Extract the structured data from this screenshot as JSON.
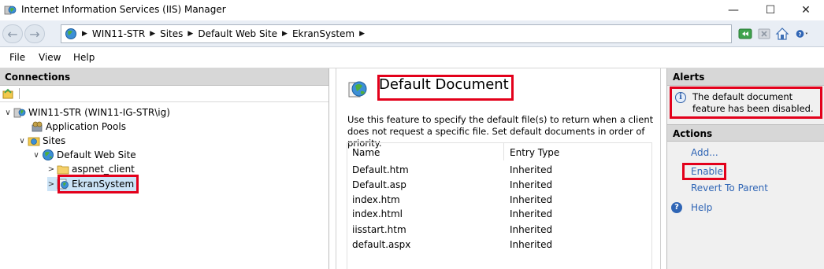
{
  "window": {
    "title": "Internet Information Services (IIS) Manager",
    "minimize_glyph": "—",
    "maximize_glyph": "☐",
    "close_glyph": "✕"
  },
  "address": {
    "back_glyph": "←",
    "forward_glyph": "→",
    "separator_glyph": "▶",
    "crumbs": [
      "WIN11-STR",
      "Sites",
      "Default Web Site",
      "EkranSystem"
    ]
  },
  "menu": {
    "items": [
      "File",
      "View",
      "Help"
    ]
  },
  "connections": {
    "header": "Connections",
    "tree": [
      {
        "label": "WIN11-STR (WIN11-IG-STR\\ig)",
        "chevron": "∨",
        "icon": "server-icon"
      },
      {
        "label": "Application Pools",
        "chevron": "",
        "icon": "app-pools-icon"
      },
      {
        "label": "Sites",
        "chevron": "∨",
        "icon": "sites-folder-icon"
      },
      {
        "label": "Default Web Site",
        "chevron": "∨",
        "icon": "globe-icon"
      },
      {
        "label": "aspnet_client",
        "chevron": ">",
        "icon": "folder-icon"
      },
      {
        "label": "EkranSystem",
        "chevron": ">",
        "icon": "web-app-icon"
      }
    ]
  },
  "feature": {
    "title": "Default Document",
    "description": "Use this feature to specify the default file(s) to return when a client does not request a specific file. Set default documents in order of priority.",
    "columns": [
      "Name",
      "Entry Type"
    ],
    "rows": [
      {
        "name": "Default.htm",
        "type": "Inherited"
      },
      {
        "name": "Default.asp",
        "type": "Inherited"
      },
      {
        "name": "index.htm",
        "type": "Inherited"
      },
      {
        "name": "index.html",
        "type": "Inherited"
      },
      {
        "name": "iisstart.htm",
        "type": "Inherited"
      },
      {
        "name": "default.aspx",
        "type": "Inherited"
      }
    ]
  },
  "alerts": {
    "header": "Alerts",
    "icon_glyph": "i",
    "message_line1": "The default document",
    "message_line2": "feature has been disabled."
  },
  "actions": {
    "header": "Actions",
    "add": "Add...",
    "enable": "Enable",
    "revert": "Revert To Parent",
    "help": "Help",
    "help_glyph": "?"
  },
  "colors": {
    "highlight": "#e3001b",
    "link": "#2f65b5"
  }
}
